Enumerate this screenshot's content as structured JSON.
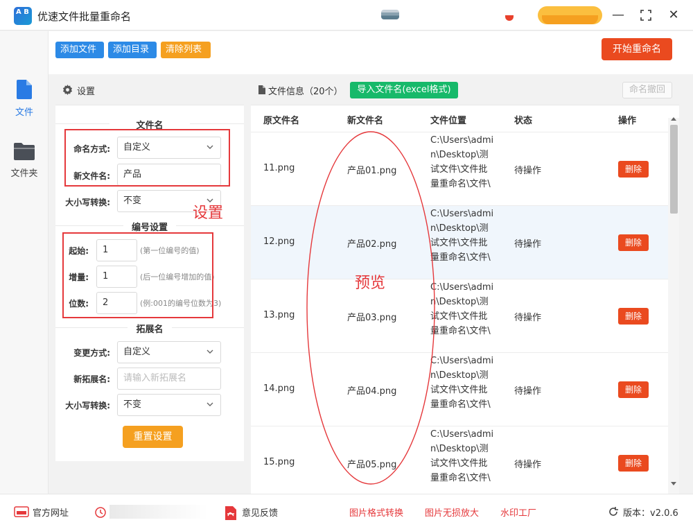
{
  "app": {
    "logo_text": "A B",
    "title": "优速文件批量重命名"
  },
  "window": {
    "minimize": "—",
    "maximize": "⛶",
    "close": "✕"
  },
  "nav": {
    "file_label": "文件",
    "folder_label": "文件夹"
  },
  "toolbar": {
    "add_file": "添加文件",
    "add_dir": "添加目录",
    "clear_list": "清除列表",
    "start_rename": "开始重命名"
  },
  "settings": {
    "title": "设置",
    "filename_section": "文件名",
    "naming_mode_label": "命名方式:",
    "naming_mode_value": "自定义",
    "new_name_label": "新文件名:",
    "new_name_value": "产品",
    "case_label": "大小写转换:",
    "case_value": "不变",
    "number_section": "编号设置",
    "start_label": "起始:",
    "start_value": "1",
    "start_hint": "(第一位编号的值)",
    "step_label": "增量:",
    "step_value": "1",
    "step_hint": "(后一位编号增加的值)",
    "digits_label": "位数:",
    "digits_value": "2",
    "digits_hint": "(例:001的编号位数为3)",
    "ext_section": "拓展名",
    "ext_mode_label": "变更方式:",
    "ext_mode_value": "自定义",
    "new_ext_label": "新拓展名:",
    "new_ext_placeholder": "请输入新拓展名",
    "ext_case_label": "大小写转换:",
    "ext_case_value": "不变",
    "reset_button": "重置设置"
  },
  "annotations": {
    "settings_label": "设置",
    "preview_label": "预览",
    "color": "#e5383b"
  },
  "files": {
    "header_title": "文件信息（20个）",
    "import_button": "导入文件名(excel格式)",
    "undo_button": "命名撤回",
    "columns": [
      "原文件名",
      "新文件名",
      "文件位置",
      "状态",
      "操作"
    ],
    "rows": [
      {
        "original": "11.png",
        "new": "产品01.png",
        "path": "C:\\Users\\admin\\Desktop\\测试文件\\文件批量重命名\\文件\\",
        "status": "待操作",
        "action": "删除"
      },
      {
        "original": "12.png",
        "new": "产品02.png",
        "path": "C:\\Users\\admin\\Desktop\\测试文件\\文件批量重命名\\文件\\",
        "status": "待操作",
        "action": "删除"
      },
      {
        "original": "13.png",
        "new": "产品03.png",
        "path": "C:\\Users\\admin\\Desktop\\测试文件\\文件批量重命名\\文件\\",
        "status": "待操作",
        "action": "删除"
      },
      {
        "original": "14.png",
        "new": "产品04.png",
        "path": "C:\\Users\\admin\\Desktop\\测试文件\\文件批量重命名\\文件\\",
        "status": "待操作",
        "action": "删除"
      },
      {
        "original": "15.png",
        "new": "产品05.png",
        "path": "C:\\Users\\admin\\Desktop\\测试文件\\文件批量重命名\\文件\\",
        "status": "待操作",
        "action": "删除"
      }
    ]
  },
  "statusbar": {
    "website": "官方网址",
    "feedback": "意见反馈",
    "image_convert": "图片格式转换",
    "image_upscale": "图片无损放大",
    "watermark": "水印工厂",
    "version": "版本：v2.0.6"
  },
  "colors": {
    "primary_blue": "#2c8ae6",
    "orange": "#f5a020",
    "red": "#ea4a1f",
    "green": "#17b96a"
  }
}
